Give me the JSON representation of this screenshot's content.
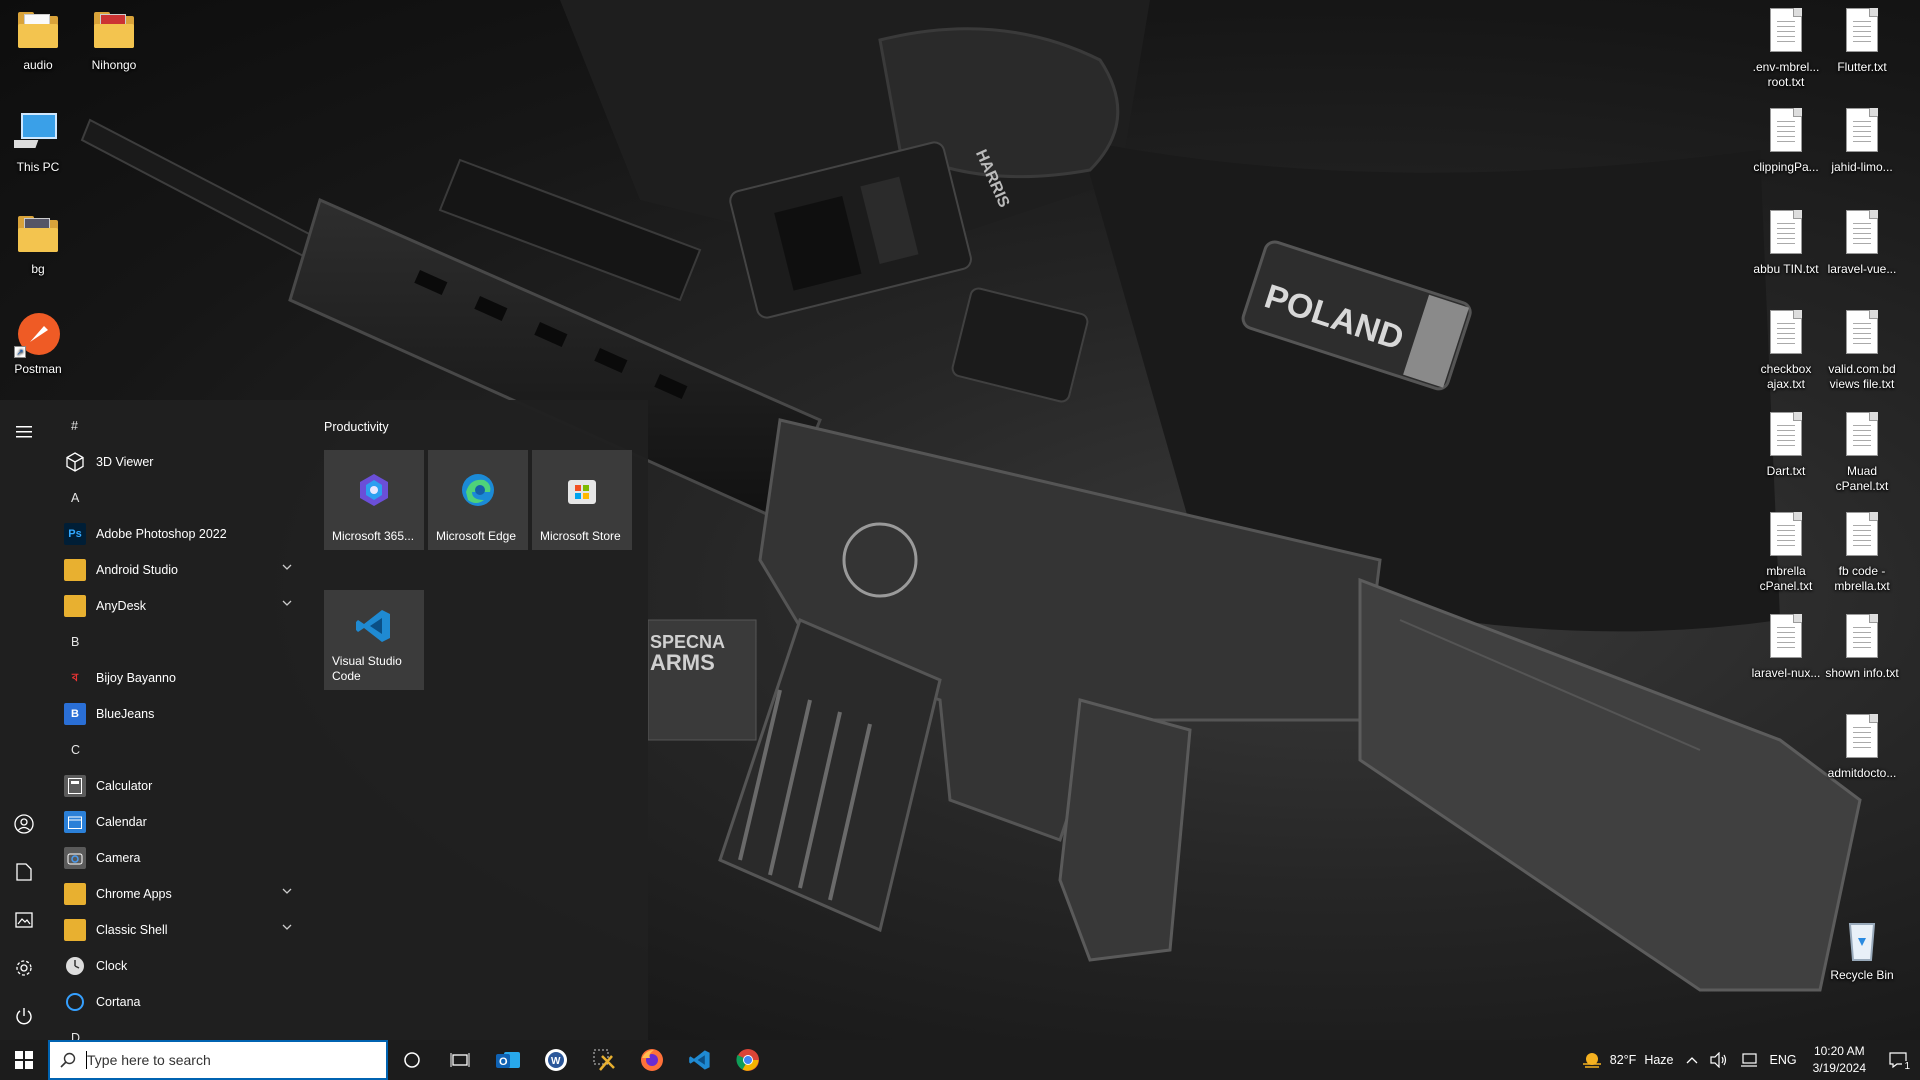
{
  "desktop": {
    "left_icons": [
      {
        "label": "audio",
        "icon": "folder-icon"
      },
      {
        "label": "Nihongo",
        "icon": "folder-icon"
      },
      {
        "label": "This PC",
        "icon": "computer-icon"
      },
      {
        "label": "bg",
        "icon": "folder-icon"
      },
      {
        "label": "Postman",
        "icon": "postman-icon"
      }
    ],
    "right_icons": [
      {
        "label": ".env-mbrel... root.txt"
      },
      {
        "label": "Flutter.txt"
      },
      {
        "label": "clippingPa..."
      },
      {
        "label": "jahid-limo..."
      },
      {
        "label": "abbu TIN.txt"
      },
      {
        "label": "laravel-vue..."
      },
      {
        "label": "checkbox ajax.txt"
      },
      {
        "label": "valid.com.bd views file.txt"
      },
      {
        "label": "Dart.txt"
      },
      {
        "label": "Muad cPanel.txt"
      },
      {
        "label": "mbrella cPanel.txt"
      },
      {
        "label": "fb code - mbrella.txt"
      },
      {
        "label": "laravel-nux..."
      },
      {
        "label": "shown info.txt"
      },
      {
        "label": "admitdocto..."
      }
    ],
    "recycle_bin": "Recycle Bin",
    "wallpaper_text": {
      "patch": "POLAND",
      "brand_1": "SPECNA",
      "brand_2": "ARMS",
      "radio": "HARRIS"
    }
  },
  "start_menu": {
    "apps": [
      {
        "kind": "letter",
        "label": "#"
      },
      {
        "kind": "app",
        "label": "3D Viewer",
        "icon": "cube-icon"
      },
      {
        "kind": "letter",
        "label": "A"
      },
      {
        "kind": "app",
        "label": "Adobe Photoshop 2022",
        "icon": "photoshop-icon"
      },
      {
        "kind": "folder",
        "label": "Android Studio",
        "icon": "folder-icon"
      },
      {
        "kind": "folder",
        "label": "AnyDesk",
        "icon": "folder-icon"
      },
      {
        "kind": "letter",
        "label": "B"
      },
      {
        "kind": "app",
        "label": "Bijoy Bayanno",
        "icon": "bijoy-icon"
      },
      {
        "kind": "app",
        "label": "BlueJeans",
        "icon": "bluejeans-icon"
      },
      {
        "kind": "letter",
        "label": "C"
      },
      {
        "kind": "app",
        "label": "Calculator",
        "icon": "calculator-icon"
      },
      {
        "kind": "app",
        "label": "Calendar",
        "icon": "calendar-icon"
      },
      {
        "kind": "app",
        "label": "Camera",
        "icon": "camera-icon"
      },
      {
        "kind": "folder",
        "label": "Chrome Apps",
        "icon": "folder-icon"
      },
      {
        "kind": "folder",
        "label": "Classic Shell",
        "icon": "folder-icon"
      },
      {
        "kind": "app",
        "label": "Clock",
        "icon": "clock-icon"
      },
      {
        "kind": "app",
        "label": "Cortana",
        "icon": "cortana-icon"
      },
      {
        "kind": "letter",
        "label": "D"
      }
    ],
    "group_title": "Productivity",
    "tiles": [
      {
        "label": "Microsoft 365...",
        "icon": "microsoft-365-icon"
      },
      {
        "label": "Microsoft Edge",
        "icon": "edge-icon"
      },
      {
        "label": "Microsoft Store",
        "icon": "store-icon"
      },
      {
        "label": "Visual Studio Code",
        "icon": "vscode-icon"
      }
    ]
  },
  "taskbar": {
    "search_placeholder": "Type here to search",
    "weather_temp": "82°F",
    "weather_desc": "Haze",
    "language": "ENG",
    "time": "10:20 AM",
    "date": "3/19/2024",
    "notification_count": "1"
  }
}
